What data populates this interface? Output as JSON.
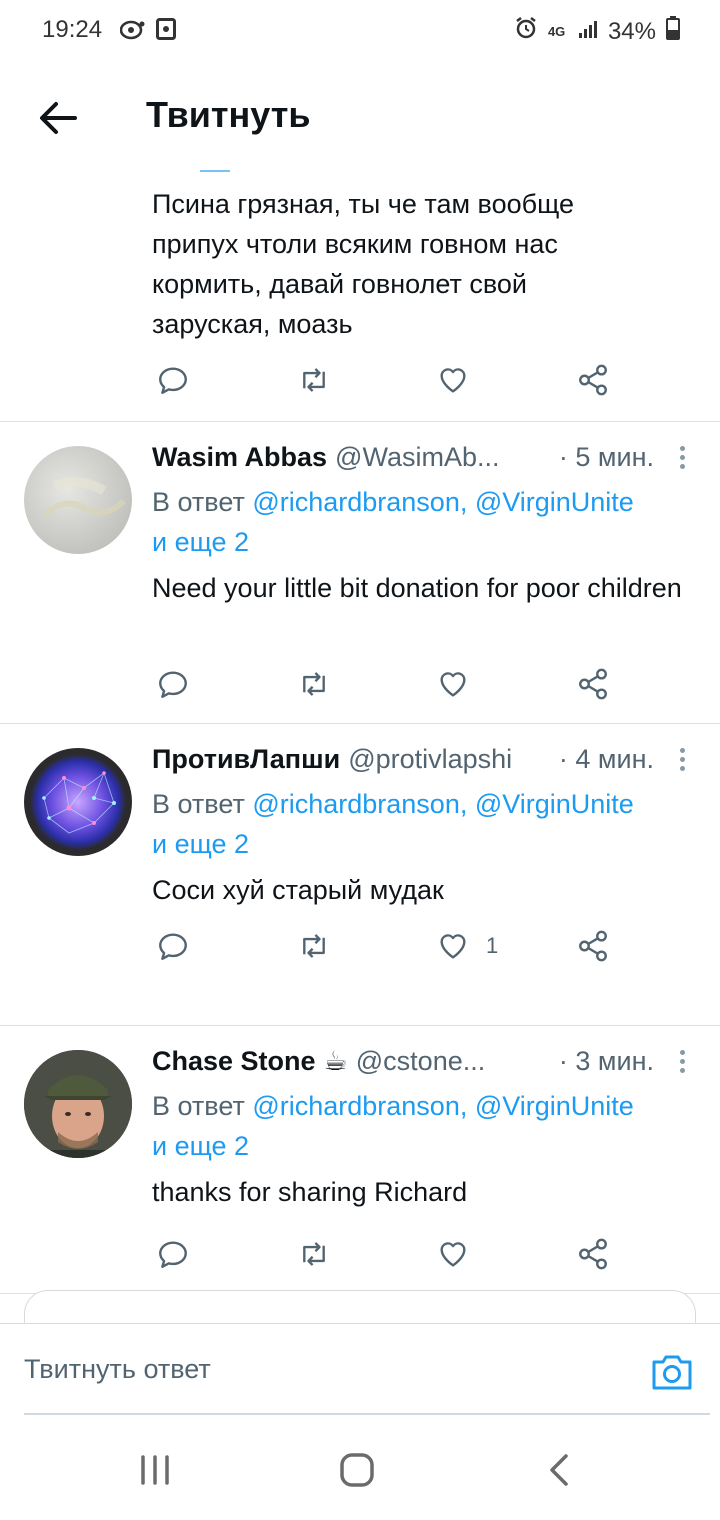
{
  "status_bar": {
    "time": "19:24",
    "network": "4G",
    "battery": "34%",
    "icons": [
      "notification-icon",
      "gallery-icon",
      "alarm-icon",
      "signal-icon",
      "battery-icon"
    ]
  },
  "header": {
    "title": "Твитнуть",
    "back_icon": "arrow-left-icon"
  },
  "tweets": [
    {
      "text": "Псина грязная, ты че там вообще припух чтоли всяким говном нас кормить, давай говнолет свой заруская, моазь"
    },
    {
      "name": "Wasim Abbas",
      "handle": "@WasimAb...",
      "time": "· 5 мин.",
      "reply_prefix": "В ответ ",
      "reply_to": "@richardbranson, @VirginUnite",
      "reply_more": "и еще 2",
      "text": "Need your little bit donation for poor children",
      "like_count": ""
    },
    {
      "name": "ПротивЛапши",
      "handle": "@protivlapshi",
      "time": "· 4 мин.",
      "reply_prefix": "В ответ ",
      "reply_to": "@richardbranson, @VirginUnite",
      "reply_more": "и еще 2",
      "text": "Соси хуй старый мудак",
      "like_count": "1"
    },
    {
      "name": "Chase Stone",
      "emoji": "☕",
      "handle": "@cstone...",
      "time": "· 3 мин.",
      "reply_prefix": "В ответ ",
      "reply_to": "@richardbranson, @VirginUnite",
      "reply_more": "и еще 2",
      "text": "thanks for sharing Richard",
      "like_count": ""
    }
  ],
  "composer": {
    "placeholder": "Твитнуть ответ"
  },
  "colors": {
    "accent": "#1d9bf0",
    "text": "#0f1419",
    "muted": "#536471",
    "divider": "#dcdfe3"
  }
}
